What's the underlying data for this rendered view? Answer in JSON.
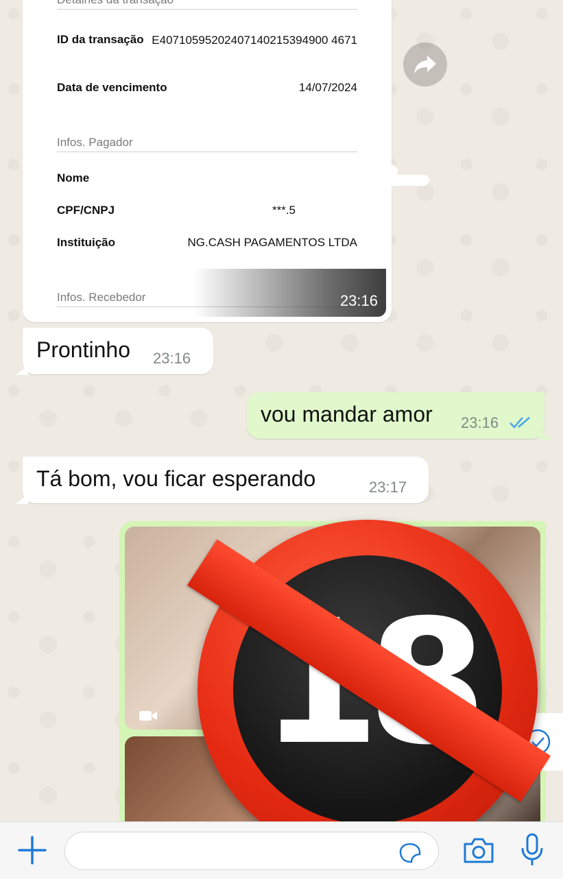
{
  "receipt": {
    "section_details": "Detalhes da transação",
    "txid_label": "ID da transação",
    "txid_value": "E40710595202407140215394900 4671",
    "due_label": "Data de vencimento",
    "due_value": "14/07/2024",
    "section_payer": "Infos. Pagador",
    "name_label": "Nome",
    "cpf_label": "CPF/CNPJ",
    "cpf_value": "***.5",
    "institution_label": "Instituição",
    "institution_value": "NG.CASH PAGAMENTOS LTDA",
    "section_receiver": "Infos. Recebedor",
    "time": "23:16"
  },
  "messages": [
    {
      "direction": "in",
      "text": "Prontinho",
      "time": "23:16"
    },
    {
      "direction": "out",
      "text": "vou mandar amor",
      "time": "23:16"
    },
    {
      "direction": "in",
      "text": "Tá bom, vou ficar esperando",
      "time": "23:17"
    }
  ],
  "album": {
    "badge_text": "18"
  },
  "composer": {
    "placeholder": ""
  },
  "colors": {
    "outgoing_bubble": "#e0f8cb",
    "incoming_bubble": "#ffffff",
    "accent_blue": "#1d7ad6",
    "read_tick": "#4fa5e8",
    "badge_red": "#e52a12"
  }
}
